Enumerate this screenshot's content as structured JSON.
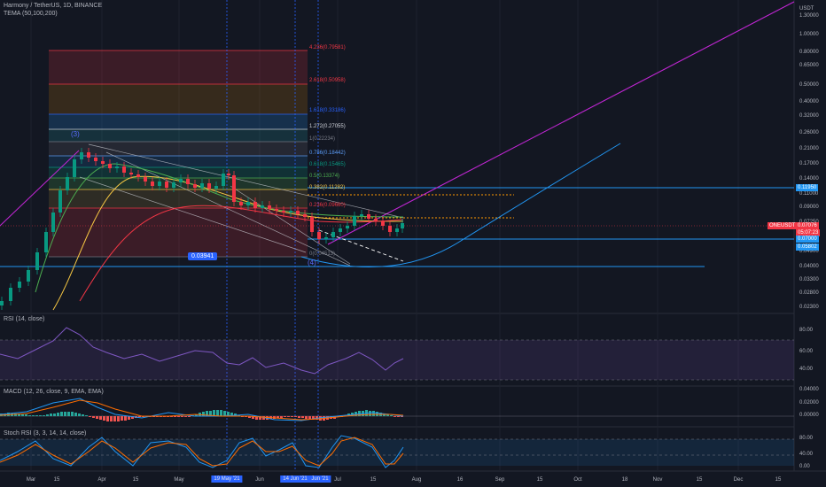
{
  "header": {
    "title": "Harmony / TetherUS, 1D, BINANCE",
    "indicator": "TEMA (50,100,200)"
  },
  "main_axis": {
    "unit": "USDT",
    "ticks": [
      "1.30000",
      "1.00000",
      "0.80000",
      "0.65000",
      "0.50000",
      "0.40000",
      "0.32000",
      "0.26000",
      "0.21000",
      "0.17000",
      "0.14000",
      "0.11000",
      "0.09000",
      "0.07250",
      "0.05900",
      "0.04900",
      "0.04000",
      "0.03300",
      "0.02800",
      "0.02300"
    ]
  },
  "price_tags": {
    "resistance": "0.11950",
    "symbol": "ONEUSDT",
    "last_price": "0.07076",
    "countdown": "05:07:23",
    "level_1": "0.07000",
    "level_2": "0.05802"
  },
  "callout": {
    "value": "0.03941"
  },
  "wave_labels": {
    "top": "(3)",
    "bottom": "(4)"
  },
  "fib_levels": [
    {
      "label": "4.236(0.79581)",
      "color": "#f23645"
    },
    {
      "label": "2.618(0.50958)",
      "color": "#f23645"
    },
    {
      "label": "1.618(0.33186)",
      "color": "#2962ff"
    },
    {
      "label": "1.272(0.27055)",
      "color": "#d1d4dc"
    },
    {
      "label": "1(0.22234)",
      "color": "#787b86"
    },
    {
      "label": "0.786(0.18442)",
      "color": "#5b9cf6"
    },
    {
      "label": "0.618(0.15465)",
      "color": "#089981"
    },
    {
      "label": "0.5(0.13374)",
      "color": "#4caf50"
    },
    {
      "label": "0.382(0.11282)",
      "color": "#f7c843"
    },
    {
      "label": "0.236(0.09660)",
      "color": "#f23645"
    },
    {
      "label": "0(0.04513)",
      "color": "#787b86"
    }
  ],
  "rsi": {
    "title": "RSI (14, close)",
    "ticks": [
      "80.00",
      "60.00",
      "40.00"
    ]
  },
  "macd": {
    "title": "MACD (12, 26, close, 9, EMA, EMA)",
    "ticks": [
      "0.04000",
      "0.02000",
      "0.00000"
    ]
  },
  "stoch": {
    "title": "Stoch RSI (3, 3, 14, 14, close)",
    "ticks": [
      "80.00",
      "40.00",
      "0.00"
    ]
  },
  "time_axis": {
    "labels": [
      "Mar",
      "15",
      "Apr",
      "15",
      "May",
      "Jun",
      "15",
      "Jul",
      "15",
      "Aug",
      "16",
      "Sep",
      "15",
      "Oct",
      "18",
      "Nov",
      "15",
      "Dec",
      "15"
    ],
    "highlighted": [
      "19 May '21",
      "14 Jun '21",
      "Jun '21"
    ]
  },
  "colors": {
    "background": "#131722",
    "bull": "#089981",
    "bear": "#f23645",
    "trendline": "#c026d3",
    "level_line": "#2196f3",
    "cursor": "#2962ff"
  }
}
